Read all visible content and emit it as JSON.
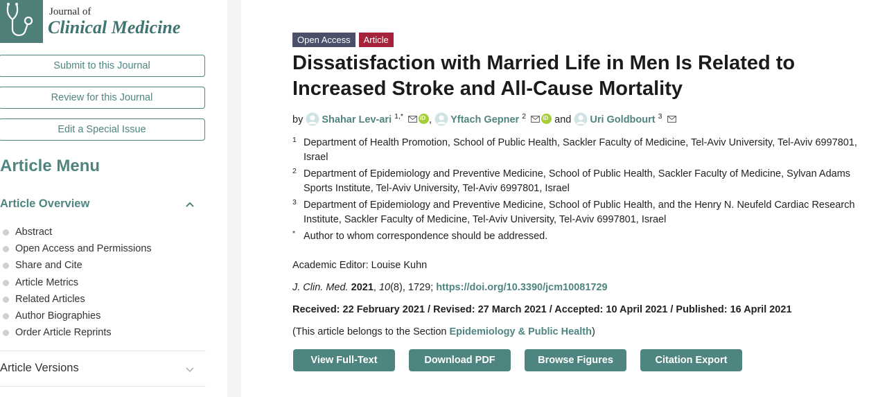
{
  "journal": {
    "name_line1": "Journal of",
    "name_line2": "Clinical Medicine"
  },
  "sidebar": {
    "buttons": [
      "Submit to this Journal",
      "Review for this Journal",
      "Edit a Special Issue"
    ],
    "menu_title": "Article Menu",
    "overview_title": "Article Overview",
    "items": [
      "Abstract",
      "Open Access and Permissions",
      "Share and Cite",
      "Article Metrics",
      "Related Articles",
      "Author Biographies",
      "Order Article Reprints"
    ],
    "versions_title": "Article Versions"
  },
  "article": {
    "badges": {
      "open_access": "Open Access",
      "type": "Article"
    },
    "title": "Dissatisfaction with Married Life in Men Is Related to Increased Stroke and All-Cause Mortality",
    "by": "by",
    "and": "and",
    "authors": [
      {
        "name": "Shahar Lev-ari",
        "sup": "1,*"
      },
      {
        "name": "Yftach Gepner",
        "sup": "2"
      },
      {
        "name": "Uri Goldbourt",
        "sup": "3"
      }
    ],
    "affiliations": [
      {
        "num": "1",
        "text": "Department of Health Promotion, School of Public Health, Sackler Faculty of Medicine, Tel-Aviv University, Tel-Aviv 6997801, Israel"
      },
      {
        "num": "2",
        "text": "Department of Epidemiology and Preventive Medicine, School of Public Health, Sackler Faculty of Medicine, Sylvan Adams Sports Institute, Tel-Aviv University, Tel-Aviv 6997801, Israel"
      },
      {
        "num": "3",
        "text": "Department of Epidemiology and Preventive Medicine, School of Public Health, and the Henry N. Neufeld Cardiac Research Institute, Sackler Faculty of Medicine, Tel-Aviv University, Tel-Aviv 6997801, Israel"
      },
      {
        "num": "*",
        "text": "Author to whom correspondence should be addressed."
      }
    ],
    "editor": "Academic Editor: Louise Kuhn",
    "citation": {
      "journal": "J. Clin. Med.",
      "year": "2021",
      "volume": "10",
      "issue_pages": "(8), 1729; ",
      "doi": "https://doi.org/10.3390/jcm10081729"
    },
    "dates": "Received: 22 February 2021 / Revised: 27 March 2021 / Accepted: 10 April 2021 / Published: 16 April 2021",
    "section": {
      "prefix": "(This article belongs to the Section ",
      "name": "Epidemiology & Public Health",
      "suffix": ")"
    },
    "actions": [
      "View Full-Text",
      "Download PDF",
      "Browse Figures",
      "Citation Export"
    ]
  },
  "colors": {
    "accent": "#4f8580",
    "open_access_badge": "#4a4f6a",
    "article_badge": "#a4233a",
    "orcid": "#a6ce39"
  }
}
